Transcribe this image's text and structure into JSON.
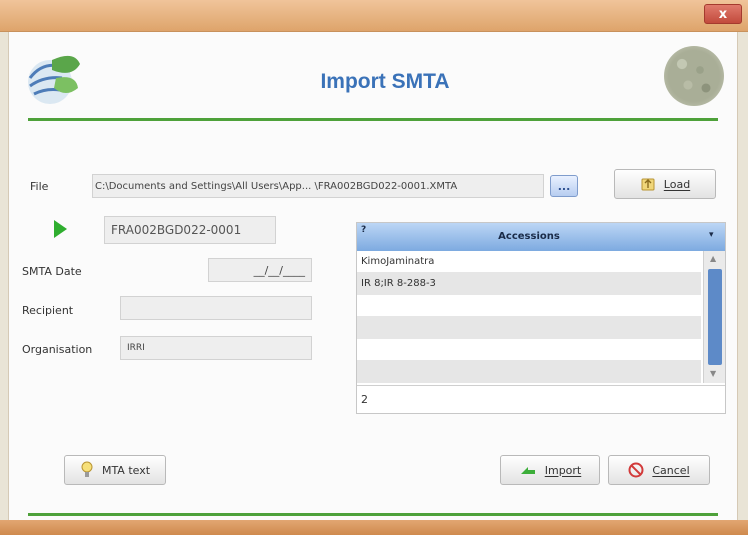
{
  "window": {
    "title": "Import SMTA",
    "close_label": "x"
  },
  "form": {
    "file_label": "File",
    "file_path": "C:\\Documents and Settings\\All Users\\App... \\FRA002BGD022-0001.XMTA",
    "browse_label": "...",
    "load_label": "Load",
    "smta_id": "FRA002BGD022-0001",
    "smta_date_label": "SMTA Date",
    "smta_date_value": "__/__/____",
    "recipient_label": "Recipient",
    "recipient_value": "",
    "organisation_label": "Organisation",
    "organisation_value": "IRRI"
  },
  "accessions": {
    "sort_indicator": "?",
    "header": "Accessions",
    "menu_icon": "▾",
    "rows": [
      "KimoJaminatra",
      "IR 8;IR 8-288-3",
      "",
      "",
      "",
      ""
    ],
    "count": "2"
  },
  "buttons": {
    "mta_text": "MTA text",
    "import": "Import",
    "cancel": "Cancel"
  },
  "colors": {
    "accent_title": "#3a72b8",
    "green_line": "#4ea13a",
    "table_header": "#7daae0"
  },
  "icons": {
    "logo_left": "leaf-globe-logo",
    "logo_right": "seed-pile-image",
    "load": "load-icon",
    "next": "play-icon",
    "mta_text": "lamp-icon",
    "import": "import-arrow-icon",
    "cancel": "no-entry-icon"
  }
}
